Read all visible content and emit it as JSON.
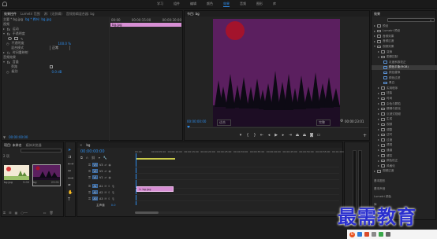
{
  "menubar": {
    "items": [
      "学习",
      "组件",
      "编辑",
      "颜色",
      "效果",
      "音频",
      "图形",
      "库"
    ],
    "active_index": 4
  },
  "effect_controls": {
    "tabs": [
      "效果控件",
      "Lumetri 范围",
      "源：(无剪辑)",
      "音频剪辑混合器: bg"
    ],
    "active_tab": 0,
    "header_source": "主要 * bg.jpg",
    "header_clip": "bg * 桦叶: bg.jpg",
    "section_video": "视频",
    "fx_motion": "运动",
    "fx_opacity": "不透明度",
    "opacity_value": "100.0 %",
    "blend_mode_label": "混合模式",
    "blend_mode_value": "正常",
    "time_remap": "时间重映射",
    "audio_fx": "音频效果",
    "volume": "音量",
    "bypass": "旁路",
    "level": "级别",
    "level_value": "0.0 dB",
    "timecode": "00:00:00:00",
    "mini_ruler": [
      "00:00",
      "00:00:15:00",
      "00:00:30:00"
    ],
    "mini_clip": "bg.jpg"
  },
  "program_monitor": {
    "title": "节目: bg",
    "current_time": "00:00:00:00",
    "fit": "适合",
    "quality": "完整",
    "duration": "00:00:23:01",
    "colors": {
      "sky": "#5b1f5f",
      "moon": "#a3132c",
      "ground": "#1d0d24"
    }
  },
  "project": {
    "tabs": [
      "项目: 未命名",
      "媒体浏览器"
    ],
    "item_count": "2 项",
    "items": [
      {
        "name": "bg.jpg",
        "duration": "5:00"
      },
      {
        "name": "bg",
        "duration": "23:01"
      }
    ]
  },
  "timeline": {
    "tab": "bg",
    "timecode": "00:00:00:00",
    "ruler": [
      "00:00",
      "00:00:05:00",
      "00:00:10:00",
      "00:00:15:00",
      "00:00:20:00",
      "00:00:25:00",
      "00:00:30:00",
      "00:00:35:00",
      "00:00:40:00",
      "00:00:45:00",
      "00:00:50:00",
      "00:00:55:00",
      "00:01:00:00"
    ],
    "tracks": [
      "V3",
      "V2",
      "V1",
      "A1",
      "A2",
      "A3"
    ],
    "master": "主声道",
    "master_value": "0.0",
    "clip_label": "bg.jpg"
  },
  "effects_panel": {
    "title": "效果",
    "tree": [
      {
        "label": "预设",
        "depth": 0,
        "open": false
      },
      {
        "label": "Lumetri 预设",
        "depth": 0,
        "open": false
      },
      {
        "label": "音频效果",
        "depth": 0,
        "open": false
      },
      {
        "label": "音频过渡",
        "depth": 0,
        "open": false
      },
      {
        "label": "视频效果",
        "depth": 0,
        "open": true
      },
      {
        "label": "变换",
        "depth": 1,
        "open": false
      },
      {
        "label": "图像控制",
        "depth": 1,
        "open": true
      },
      {
        "label": "灰度系数校正",
        "depth": 2,
        "open": false
      },
      {
        "label": "颜色平衡(RGB)",
        "depth": 2,
        "open": false,
        "selected": true
      },
      {
        "label": "颜色替换",
        "depth": 2,
        "open": false
      },
      {
        "label": "颜色过滤",
        "depth": 2,
        "open": false
      },
      {
        "label": "黑白",
        "depth": 2,
        "open": false
      },
      {
        "label": "实用程序",
        "depth": 1,
        "open": false
      },
      {
        "label": "扭曲",
        "depth": 1,
        "open": false
      },
      {
        "label": "时间",
        "depth": 1,
        "open": false
      },
      {
        "label": "杂色与颗粒",
        "depth": 1,
        "open": false
      },
      {
        "label": "模糊与锐化",
        "depth": 1,
        "open": false
      },
      {
        "label": "沉浸式视频",
        "depth": 1,
        "open": false
      },
      {
        "label": "生成",
        "depth": 1,
        "open": false
      },
      {
        "label": "视频",
        "depth": 1,
        "open": false
      },
      {
        "label": "调整",
        "depth": 1,
        "open": false
      },
      {
        "label": "过时",
        "depth": 1,
        "open": false
      },
      {
        "label": "过渡",
        "depth": 1,
        "open": false
      },
      {
        "label": "透视",
        "depth": 1,
        "open": false
      },
      {
        "label": "通道",
        "depth": 1,
        "open": false
      },
      {
        "label": "键控",
        "depth": 1,
        "open": false
      },
      {
        "label": "颜色校正",
        "depth": 1,
        "open": false
      },
      {
        "label": "风格化",
        "depth": 1,
        "open": false
      },
      {
        "label": "视频过渡",
        "depth": 0,
        "open": false
      }
    ],
    "lower_items": [
      "基本图形",
      "基本声音",
      "Lumetri 颜色",
      "库",
      "标记"
    ]
  },
  "watermark": {
    "text": "最需教育",
    "badge": "U"
  }
}
